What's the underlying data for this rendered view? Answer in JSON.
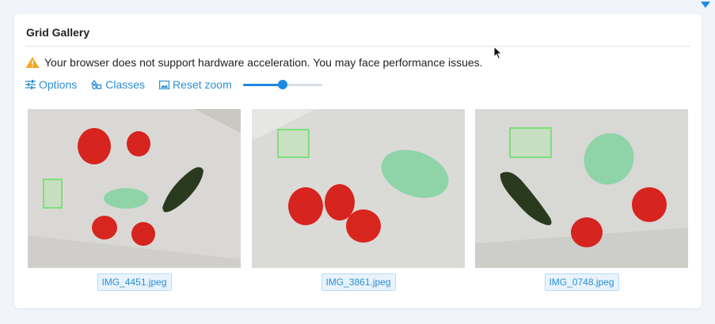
{
  "gallery": {
    "title": "Grid Gallery",
    "warning_text": "Your browser does not support hardware acceleration. You may face performance issues.",
    "toolbar": {
      "options_label": "Options",
      "classes_label": "Classes",
      "reset_zoom_label": "Reset zoom",
      "zoom_fraction": 0.5
    },
    "images": [
      {
        "filename": "IMG_4451.jpeg"
      },
      {
        "filename": "IMG_3861.jpeg"
      },
      {
        "filename": "IMG_0748.jpeg"
      }
    ]
  },
  "colors": {
    "accent": "#2a8fd4",
    "warning": "#f5a623",
    "annotation_box": "#7de07a"
  }
}
